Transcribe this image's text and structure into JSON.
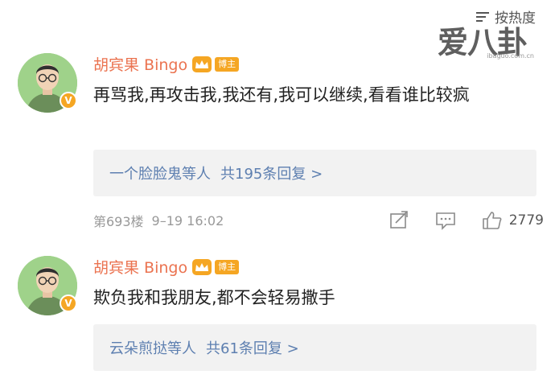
{
  "sort": {
    "label": "按热度",
    "icon": "sort-lines-icon"
  },
  "watermark": {
    "text": "爱八卦",
    "url": "ibaguo.com.cn"
  },
  "comments": [
    {
      "username": "胡宾果 Bingo",
      "badge": "博主",
      "text": "再骂我,再攻击我,我还有,我可以继续,看看谁比较疯",
      "reply_names": "一个脸脸鬼",
      "reply_suffix": "等人",
      "reply_count": "共195条回复 >",
      "floor": "第693楼",
      "time": "9–19 16:02",
      "likes": "2779"
    },
    {
      "username": "胡宾果 Bingo",
      "badge": "博主",
      "text": "欺负我和我朋友,都不会轻易撒手",
      "reply_names": "云朵煎挞",
      "reply_suffix": "等人",
      "reply_count": "共61条回复 >"
    }
  ],
  "colors": {
    "username": "#eb7350",
    "link": "#5d7fb0",
    "badge": "#f5a623",
    "avatar_bg": "#9fd28a"
  },
  "icons": {
    "crown": "crown-icon",
    "repost": "repost-icon",
    "comment": "comment-icon",
    "like": "thumbs-up-icon",
    "verified": "verified-v-icon"
  }
}
